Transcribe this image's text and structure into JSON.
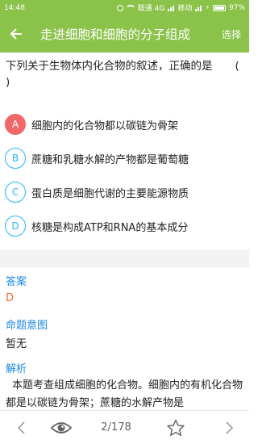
{
  "status_bar": {
    "time": "14:48",
    "carrier1": "联通 4G",
    "carrier2": "移动",
    "battery": "97%"
  },
  "header": {
    "title": "走进细胞和细胞的分子组成",
    "select_label": "选择",
    "back_icon": "arrow-left-icon"
  },
  "question": {
    "text": "下列关于生物体内化合物的叙述，正确的是",
    "blank": "(      )",
    "options": [
      {
        "letter": "A",
        "text": "细胞内的化合物都以碳链为骨架",
        "selected": true
      },
      {
        "letter": "B",
        "text": "蔗糖和乳糖水解的产物都是葡萄糖",
        "selected": false
      },
      {
        "letter": "C",
        "text": "蛋白质是细胞代谢的主要能源物质",
        "selected": false
      },
      {
        "letter": "D",
        "text": "核糖是构成ATP和RNA的基本成分",
        "selected": false
      }
    ]
  },
  "answer": {
    "title": "答案",
    "value": "D"
  },
  "intent": {
    "title": "命题意图",
    "value": "暂无"
  },
  "analysis": {
    "title": "解析",
    "text": "本题考查组成细胞的化合物。细胞内的有机化合物都是以碳链为骨架；蔗糖的水解产物是"
  },
  "bottom_bar": {
    "page": "2/178"
  },
  "colors": {
    "accent": "#8bc34a",
    "selected": "#f06968",
    "option_outline": "#29b6f6",
    "section_title": "#1e88e5",
    "answer": "#ef6c28"
  }
}
